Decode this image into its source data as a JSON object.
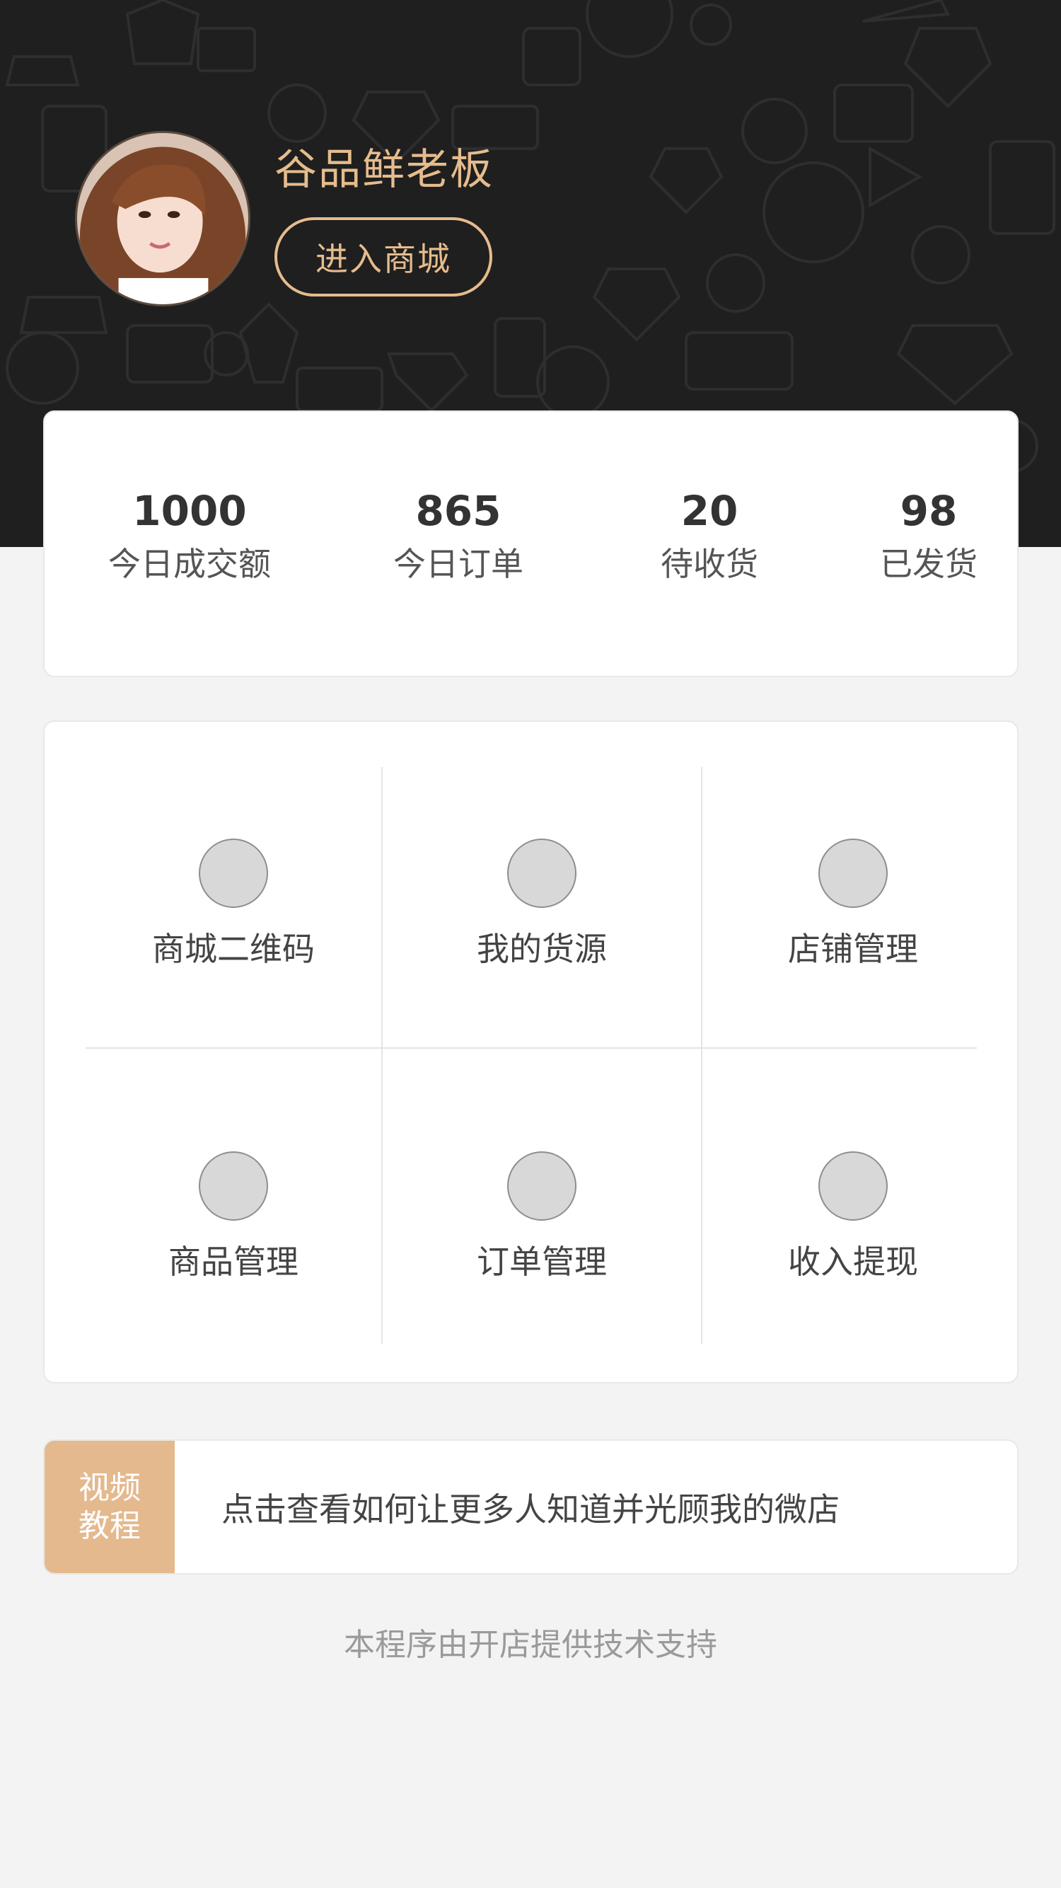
{
  "header": {
    "shop_name": "谷品鲜老板",
    "enter_button": "进入商城",
    "background_color": "#1f1f1f",
    "accent_color": "#e6bc8d"
  },
  "stats": [
    {
      "value": "1000",
      "label": "今日成交额"
    },
    {
      "value": "865",
      "label": "今日订单"
    },
    {
      "value": "20",
      "label": "待收货"
    },
    {
      "value": "98",
      "label": "已发货"
    }
  ],
  "menu": [
    {
      "label": "商城二维码",
      "icon": "qrcode-icon"
    },
    {
      "label": "我的货源",
      "icon": "supply-icon"
    },
    {
      "label": "店铺管理",
      "icon": "store-icon"
    },
    {
      "label": "商品管理",
      "icon": "goods-icon"
    },
    {
      "label": "订单管理",
      "icon": "order-icon"
    },
    {
      "label": "收入提现",
      "icon": "withdraw-icon"
    }
  ],
  "video": {
    "tag_line1": "视频",
    "tag_line2": "教程",
    "text": "点击查看如何让更多人知道并光顾我的微店",
    "tag_color": "#e4b98e"
  },
  "footer": "本程序由开店提供技术支持"
}
